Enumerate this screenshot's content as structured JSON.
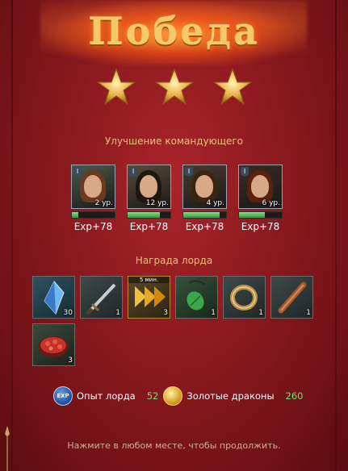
{
  "title": "Победа",
  "stars_earned": 3,
  "commander_section": {
    "title": "Улучшение командующего",
    "commanders": [
      {
        "rank": "I",
        "level": "2 ур.",
        "exp": "Exp+78",
        "xp_fill": 0.15,
        "hair": "#6b3a1f",
        "bg": "#4a5a4a"
      },
      {
        "rank": "I",
        "level": "12 ур.",
        "exp": "Exp+78",
        "xp_fill": 0.75,
        "hair": "#1f1610",
        "bg": "#5a4a3a"
      },
      {
        "rank": "I",
        "level": "4 ур.",
        "exp": "Exp+78",
        "xp_fill": 0.85,
        "hair": "#3a2510",
        "bg": "#4a3a2a"
      },
      {
        "rank": "I",
        "level": "6 ур.",
        "exp": "Exp+78",
        "xp_fill": 0.6,
        "hair": "#5a2010",
        "bg": "#3a2a22"
      }
    ]
  },
  "reward_section": {
    "title": "Награда лорда",
    "items": [
      {
        "icon": "crystal-icon",
        "count": "30",
        "timer": ""
      },
      {
        "icon": "sword-icon",
        "count": "1",
        "timer": ""
      },
      {
        "icon": "speedup-icon",
        "count": "3",
        "timer": "5 мин."
      },
      {
        "icon": "pendant-icon",
        "count": "1",
        "timer": ""
      },
      {
        "icon": "ring-icon",
        "count": "1",
        "timer": ""
      },
      {
        "icon": "scroll-icon",
        "count": "1",
        "timer": ""
      },
      {
        "icon": "food-icon",
        "count": "3",
        "timer": ""
      }
    ]
  },
  "summary": {
    "exp_coin_label": "EXP",
    "lord_exp_label": "Опыт лорда",
    "lord_exp_value": "52",
    "gold_label": "Золотые драконы",
    "gold_value": "260"
  },
  "continue_text": "Нажмите в любом месте, чтобы продолжить.",
  "colors": {
    "accent_gold": "#f0c27a",
    "value_green": "#6fe36f",
    "background_red": "#8d1a1f"
  }
}
